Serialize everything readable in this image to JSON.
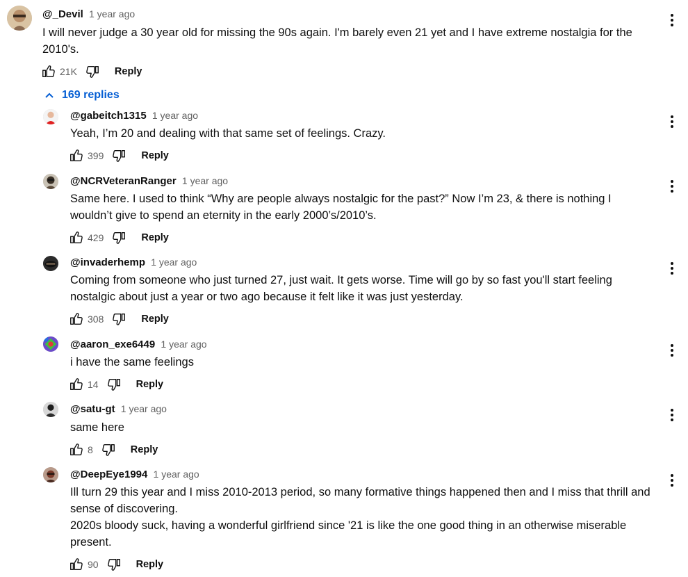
{
  "top_comment": {
    "author": "@_Devil",
    "time": "1 year ago",
    "text": "I will never judge a 30 year old for missing the 90s again. I'm barely even 21 yet and I have extreme nostalgia for the 2010's.",
    "likes": "21K",
    "reply_label": "Reply",
    "avatar_color": "#d9c3a3"
  },
  "replies_toggle": {
    "label": "169 replies",
    "color": "#065fd4",
    "icon": "chevron-up-icon"
  },
  "replies": [
    {
      "author": "@gabeitch1315",
      "time": "1 year ago",
      "text": [
        "Yeah, I’m 20 and dealing with that same set of feelings. Crazy."
      ],
      "likes": "399",
      "reply_label": "Reply",
      "avatar_color": "#e02020"
    },
    {
      "author": "@NCRVeteranRanger",
      "time": "1 year ago",
      "text": [
        "Same here. I used to think “Why are people always nostalgic for the past?” Now I’m 23, & there is nothing I wouldn’t give to spend an eternity in the early 2000’s/2010’s."
      ],
      "likes": "429",
      "reply_label": "Reply",
      "avatar_color": "#5a4a3a"
    },
    {
      "author": "@invaderhemp",
      "time": "1 year ago",
      "text": [
        "Coming from someone who just turned 27, just wait. It gets worse. Time will go by so fast you'll start feeling nostalgic about just a year or two ago because it felt like it was just yesterday."
      ],
      "likes": "308",
      "reply_label": "Reply",
      "avatar_color": "#2b2b2b"
    },
    {
      "author": "@aaron_exe6449",
      "time": "1 year ago",
      "text": [
        "i have the same feelings"
      ],
      "likes": "14",
      "reply_label": "Reply",
      "avatar_color": "#6b4cc9"
    },
    {
      "author": "@satu-gt",
      "time": "1 year ago",
      "text": [
        "same here"
      ],
      "likes": "8",
      "reply_label": "Reply",
      "avatar_color": "#3a3a3a"
    },
    {
      "author": "@DeepEye1994",
      "time": "1 year ago",
      "text": [
        "Ill turn 29 this year and I miss 2010-2013 period, so many formative things happened then and I miss that thrill and sense of discovering.",
        "2020s bloody suck, having a wonderful girlfriend since '21 is like the one good thing in an otherwise miserable present."
      ],
      "likes": "90",
      "reply_label": "Reply",
      "avatar_color": "#8a4a3a"
    }
  ]
}
